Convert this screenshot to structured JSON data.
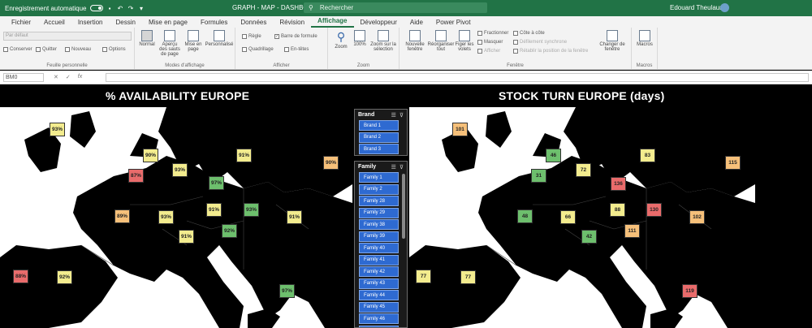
{
  "titlebar": {
    "autosave_label": "Enregistrement automatique",
    "doc_title": "GRAPH - MAP - DASHBOARD",
    "search_placeholder": "Rechercher",
    "user_name": "Edouard Theulaur"
  },
  "menu": {
    "tabs": [
      "Fichier",
      "Accueil",
      "Insertion",
      "Dessin",
      "Mise en page",
      "Formules",
      "Données",
      "Révision",
      "Affichage",
      "Développeur",
      "Aide",
      "Power Pivot"
    ],
    "active": "Affichage"
  },
  "ribbon": {
    "sheet_view_dropdown": "Par défaut",
    "sheet_view_buttons": [
      "Conserver",
      "Quitter",
      "Nouveau",
      "Options"
    ],
    "group_sheet_view": "Feuille personnelle",
    "view_buttons": [
      "Normal",
      "Aperçu des sauts de page",
      "Mise en page",
      "Personnalisé"
    ],
    "group_views": "Modes d'affichage",
    "show_items": [
      "Règle",
      "Barre de formule",
      "Quadrillage",
      "En-têtes"
    ],
    "group_show": "Afficher",
    "zoom_buttons": [
      "Zoom",
      "100%",
      "Zoom sur la sélection"
    ],
    "group_zoom": "Zoom",
    "window_buttons": [
      "Nouvelle fenêtre",
      "Réorganiser tout",
      "Figer les volets"
    ],
    "window_small": [
      "Fractionner",
      "Masquer",
      "Afficher"
    ],
    "window_small2": [
      "Côte à côte",
      "Défilement synchrone",
      "Rétablir la position de la fenêtre"
    ],
    "change_window": "Changer de fenêtre",
    "group_window": "Fenêtre",
    "macros": "Macros",
    "group_macros": "Macros"
  },
  "formula_bar": {
    "name_box": "BM0",
    "formula": ""
  },
  "dashboard": {
    "left_title": "% AVAILABILITY EUROPE",
    "right_title": "STOCK TURN EUROPE (days)",
    "colors": {
      "green": "#6dbf6d",
      "yellow": "#f3ec8e",
      "orange": "#f6c07a",
      "red": "#e96b6b",
      "slicer_blue": "#2e6ad1"
    },
    "availability": [
      {
        "label": "93%",
        "color": "yellow"
      },
      {
        "label": "90%",
        "color": "yellow"
      },
      {
        "label": "87%",
        "color": "red"
      },
      {
        "label": "93%",
        "color": "yellow"
      },
      {
        "label": "91%",
        "color": "yellow"
      },
      {
        "label": "90%",
        "color": "orange"
      },
      {
        "label": "97%",
        "color": "green"
      },
      {
        "label": "89%",
        "color": "orange"
      },
      {
        "label": "93%",
        "color": "yellow"
      },
      {
        "label": "91%",
        "color": "yellow"
      },
      {
        "label": "93%",
        "color": "green"
      },
      {
        "label": "91%",
        "color": "yellow"
      },
      {
        "label": "91%",
        "color": "yellow"
      },
      {
        "label": "92%",
        "color": "green"
      },
      {
        "label": "88%",
        "color": "red"
      },
      {
        "label": "92%",
        "color": "yellow"
      },
      {
        "label": "97%",
        "color": "green"
      }
    ],
    "stock_turn": [
      {
        "label": "101",
        "color": "orange"
      },
      {
        "label": "46",
        "color": "green"
      },
      {
        "label": "72",
        "color": "yellow"
      },
      {
        "label": "83",
        "color": "yellow"
      },
      {
        "label": "115",
        "color": "orange"
      },
      {
        "label": "31",
        "color": "green"
      },
      {
        "label": "136",
        "color": "red"
      },
      {
        "label": "48",
        "color": "green"
      },
      {
        "label": "66",
        "color": "yellow"
      },
      {
        "label": "88",
        "color": "yellow"
      },
      {
        "label": "130",
        "color": "red"
      },
      {
        "label": "102",
        "color": "orange"
      },
      {
        "label": "42",
        "color": "green"
      },
      {
        "label": "111",
        "color": "orange"
      },
      {
        "label": "77",
        "color": "yellow"
      },
      {
        "label": "77",
        "color": "yellow"
      },
      {
        "label": "119",
        "color": "red"
      }
    ],
    "brand_slicer": {
      "title": "Brand",
      "items": [
        "Brand 1",
        "Brand 2",
        "Brand 3"
      ]
    },
    "family_slicer": {
      "title": "Family",
      "items": [
        "Family 1",
        "Family 2",
        "Family 28",
        "Family 29",
        "Family 38",
        "Family 39",
        "Family 40",
        "Family 41",
        "Family 42",
        "Family 43",
        "Family 44",
        "Family 45",
        "Family 46",
        "Family 47"
      ]
    }
  }
}
